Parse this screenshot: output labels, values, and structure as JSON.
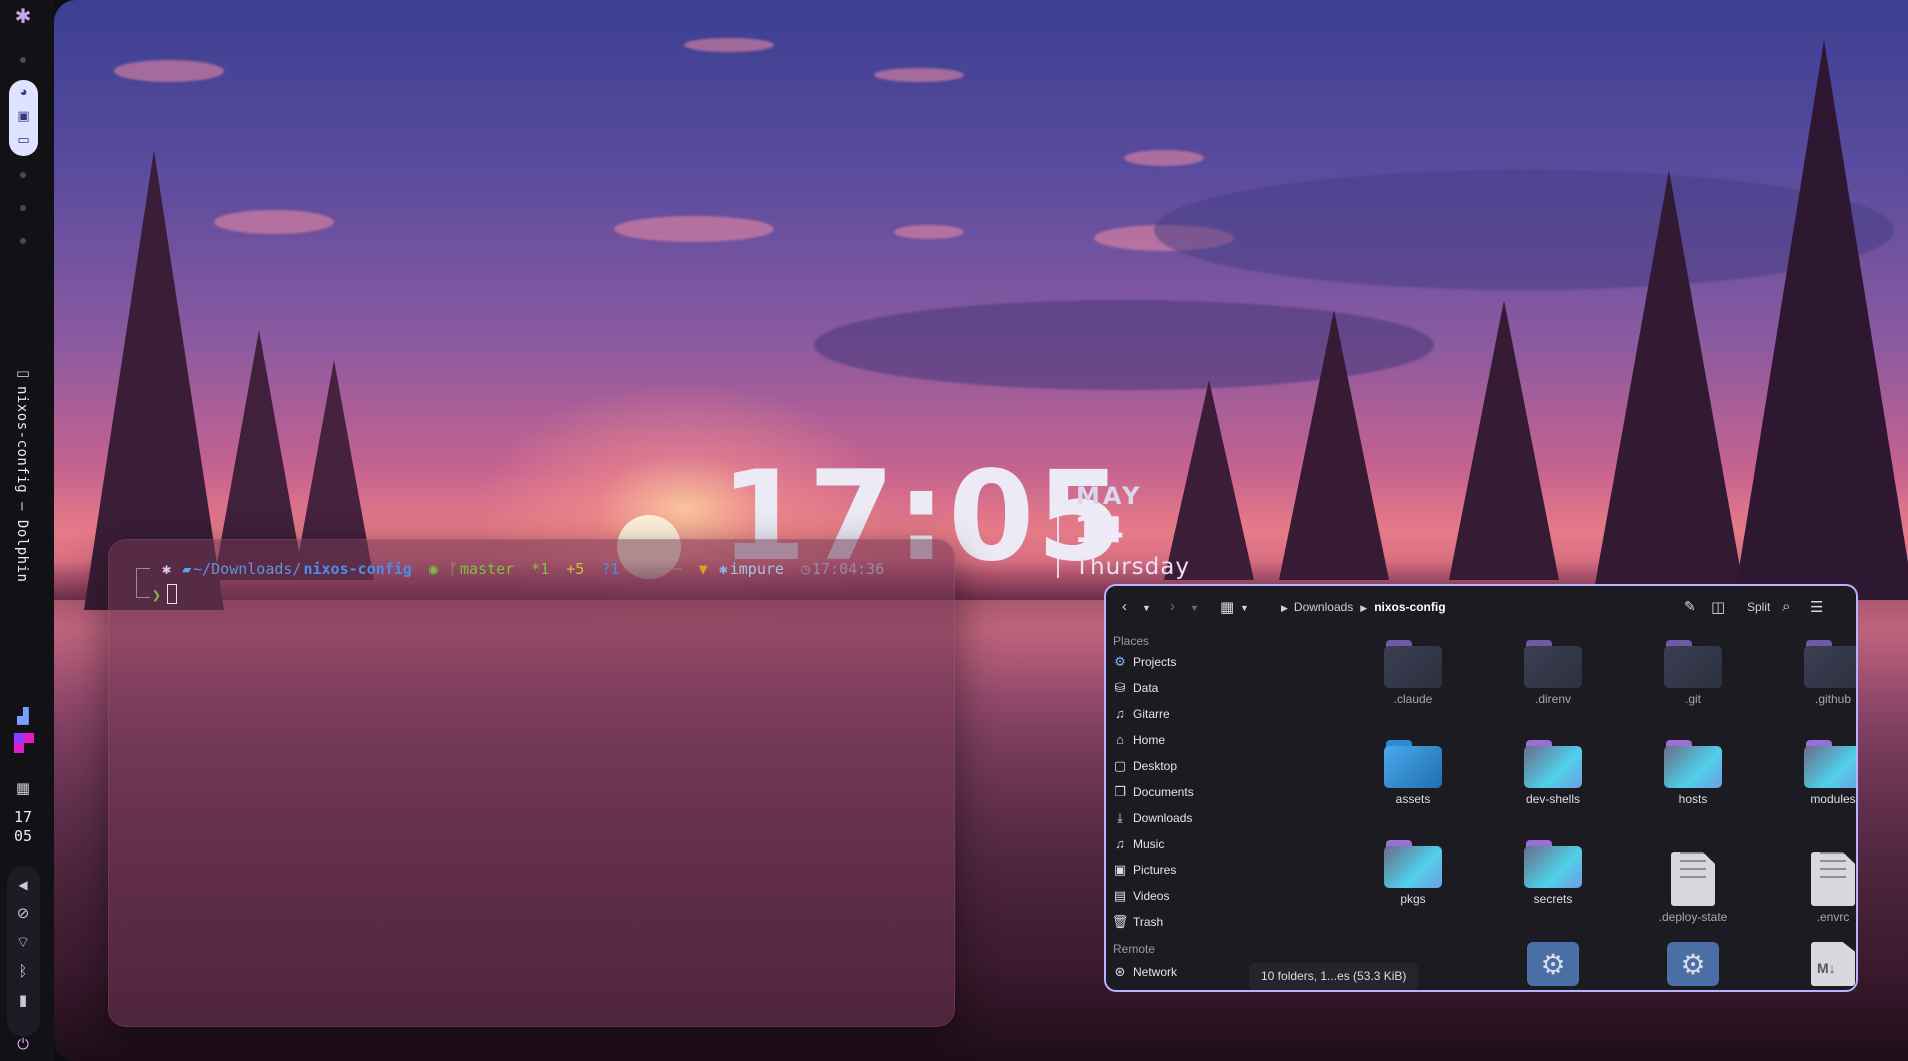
{
  "dock": {
    "workspace_icons": [
      "pac-man-icon",
      "image-window-icon",
      "terminal-window-icon"
    ],
    "window_icon": "window-icon",
    "window_title": "nixos-config — Dolphin",
    "clock_hour": "17",
    "clock_minute": "05",
    "status_icons": [
      "chevron-left-icon",
      "mic-muted-icon",
      "wifi-icon",
      "bluetooth-icon",
      "battery-icon",
      "power-icon"
    ]
  },
  "desktop_clock": {
    "time": "17:05",
    "month": "MAY",
    "day": "14",
    "weekday": "Thursday"
  },
  "terminal": {
    "path_prefix": "~/Downloads/",
    "path_dir": "nixos-config",
    "branch": "master",
    "git_staged": "*1",
    "git_added": "+5",
    "git_untracked": "?1",
    "env_marker": "▼",
    "env_label": "impure",
    "time": "17:04:36",
    "prompt_char": "❯"
  },
  "file_manager": {
    "breadcrumb": [
      "Downloads",
      "nixos-config"
    ],
    "split_label": "Split",
    "places_header": "Places",
    "places": [
      {
        "label": "Projects",
        "icon": "projects-gear-icon"
      },
      {
        "label": "Data",
        "icon": "database-icon"
      },
      {
        "label": "Gitarre",
        "icon": "music-note-icon"
      },
      {
        "label": "Home",
        "icon": "home-icon"
      },
      {
        "label": "Desktop",
        "icon": "desktop-icon"
      },
      {
        "label": "Documents",
        "icon": "documents-icon"
      },
      {
        "label": "Downloads",
        "icon": "download-icon"
      },
      {
        "label": "Music",
        "icon": "music-icon"
      },
      {
        "label": "Pictures",
        "icon": "pictures-icon"
      },
      {
        "label": "Videos",
        "icon": "videos-icon"
      },
      {
        "label": "Trash",
        "icon": "trash-icon"
      }
    ],
    "remote_header": "Remote",
    "remote": [
      {
        "label": "Network",
        "icon": "network-icon"
      }
    ],
    "files": [
      {
        "name": ".claude",
        "kind": "folder-dark"
      },
      {
        "name": ".direnv",
        "kind": "folder-dark"
      },
      {
        "name": ".git",
        "kind": "folder-dark"
      },
      {
        "name": ".github",
        "kind": "folder-dark"
      },
      {
        "name": "assets",
        "kind": "folder-assets"
      },
      {
        "name": "dev-shells",
        "kind": "folder"
      },
      {
        "name": "hosts",
        "kind": "folder"
      },
      {
        "name": "modules",
        "kind": "folder"
      },
      {
        "name": "pkgs",
        "kind": "folder"
      },
      {
        "name": "secrets",
        "kind": "folder"
      },
      {
        "name": ".deploy-state",
        "kind": "text-file"
      },
      {
        "name": ".envrc",
        "kind": "text-file"
      }
    ],
    "status": "10 folders, 1...es (53.3 KiB)"
  }
}
